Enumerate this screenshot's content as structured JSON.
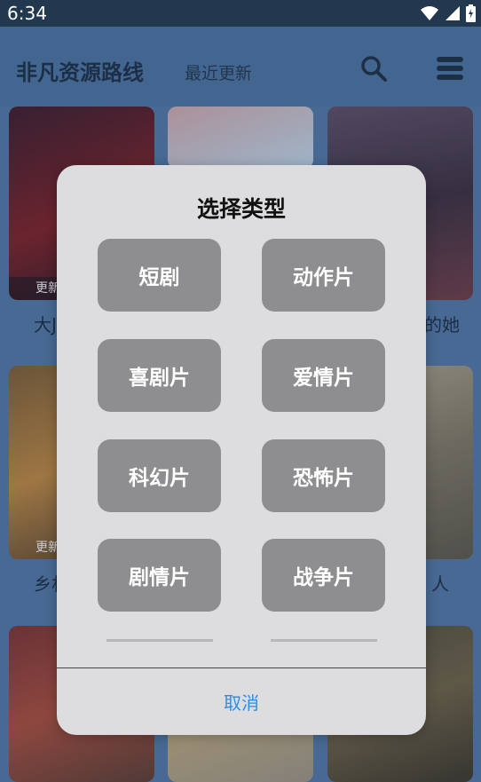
{
  "status_bar": {
    "time": "6:34"
  },
  "header": {
    "title": "非凡资源路线",
    "subtitle": "最近更新"
  },
  "cards": [
    {
      "label": "大J",
      "badge": "更新"
    },
    {
      "label": "",
      "badge": ""
    },
    {
      "label": "的她",
      "badge": ""
    },
    {
      "label": "乡村",
      "badge": "更新"
    },
    {
      "label": "",
      "badge": ""
    },
    {
      "label": "人",
      "badge": ""
    }
  ],
  "dialog": {
    "title": "选择类型",
    "types": [
      "短剧",
      "动作片",
      "喜剧片",
      "爱情片",
      "科幻片",
      "恐怖片",
      "剧情片",
      "战争片"
    ],
    "cancel_label": "取消"
  },
  "colors": {
    "accent": "#2f8de4",
    "button": "#8e8e90",
    "dialog_bg": "#dddde0",
    "header_bg": "#22384f"
  },
  "icons": [
    "wifi-icon",
    "signal-icon",
    "battery-icon",
    "search-icon",
    "menu-icon"
  ]
}
